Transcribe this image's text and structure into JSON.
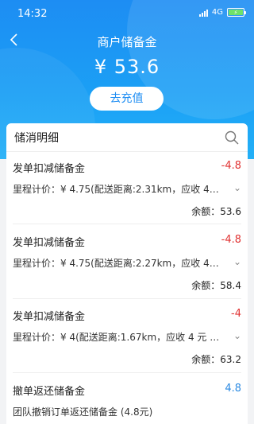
{
  "status_bar": {
    "time": "14:32",
    "network": "4G"
  },
  "header": {
    "title": "商户储备金",
    "amount": "¥ 53.6",
    "recharge_label": "去充值"
  },
  "list": {
    "title": "储消明细",
    "records": [
      {
        "title": "发单扣减储备金",
        "amount": "-4.8",
        "detail": "里程计价：¥ 4.75(配送距离:2.31km，应收 4.75…",
        "balance": "余额：53.6"
      },
      {
        "title": "发单扣减储备金",
        "amount": "-4.8",
        "detail": "里程计价：¥ 4.75(配送距离:2.27km，应收 4.75…",
        "balance": "余额：58.4"
      },
      {
        "title": "发单扣减储备金",
        "amount": "-4",
        "detail": "里程计价：¥ 4(配送距离:1.67km，应收 4 元 (06:…",
        "balance": "余额：63.2"
      },
      {
        "title": "撤单返还储备金",
        "amount": "4.8",
        "detail": "团队撤销订单返还储备金 (4.8元)",
        "balance": ""
      }
    ]
  },
  "colors": {
    "brand_blue": "#1d8df3",
    "negative": "#e03131",
    "positive": "#2b8ae2"
  }
}
